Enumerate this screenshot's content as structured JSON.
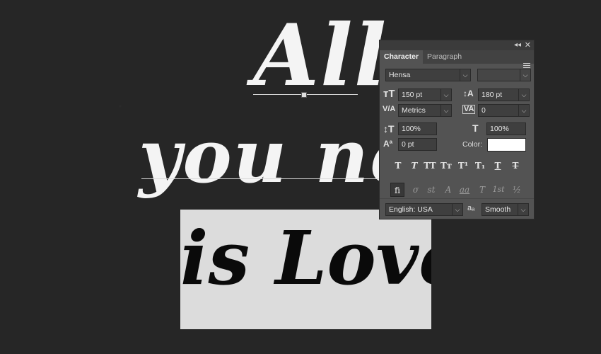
{
  "canvas": {
    "line1": "All",
    "line2": "you ne",
    "line3": "is Love"
  },
  "panel": {
    "tabs": [
      "Character",
      "Paragraph"
    ],
    "font_family": "Hensa",
    "font_style": "",
    "font_size": "150 pt",
    "leading": "180 pt",
    "kerning": "Metrics",
    "tracking": "0",
    "vertical_scale": "100%",
    "horizontal_scale": "100%",
    "baseline_shift": "0 pt",
    "color_label": "Color:",
    "color_value": "#ffffff",
    "language": "English: USA",
    "antialias_symbol": "aₐ",
    "antialias": "Smooth",
    "style_buttons": [
      "T",
      "T",
      "TT",
      "Tт",
      "T¹",
      "T₁",
      "T",
      "T"
    ],
    "opentype_buttons": [
      "fi",
      "σ",
      "st",
      "A",
      "aa",
      "T",
      "1st",
      "½"
    ]
  }
}
